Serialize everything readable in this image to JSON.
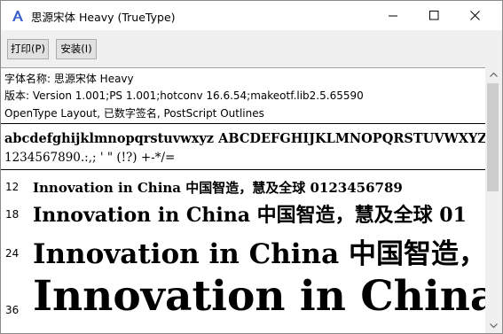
{
  "window": {
    "title": "思源宋体 Heavy (TrueType)"
  },
  "toolbar": {
    "print_label": "打印(P)",
    "install_label": "安装(I)"
  },
  "info": {
    "font_name_line": "字体名称: 思源宋体 Heavy",
    "version_line": "版本: Version 1.001;PS 1.001;hotconv 16.6.54;makeotf.lib2.5.65590",
    "features_line": "OpenType Layout, 已数字签名, PostScript Outlines"
  },
  "charset": {
    "letters": "abcdefghijklmnopqrstuvwxyz ABCDEFGHIJKLMNOPQRSTUVWXYZ",
    "digits_symbols": "1234567890.:,; ' \" (!?) +-*/="
  },
  "samples": [
    {
      "size": "12",
      "text": "Innovation in China 中国智造，慧及全球 0123456789"
    },
    {
      "size": "18",
      "text": "Innovation in China 中国智造，慧及全球 01"
    },
    {
      "size": "24",
      "text": "Innovation in China 中国智造，慧"
    },
    {
      "size": "36",
      "text": "Innovation in China"
    }
  ]
}
